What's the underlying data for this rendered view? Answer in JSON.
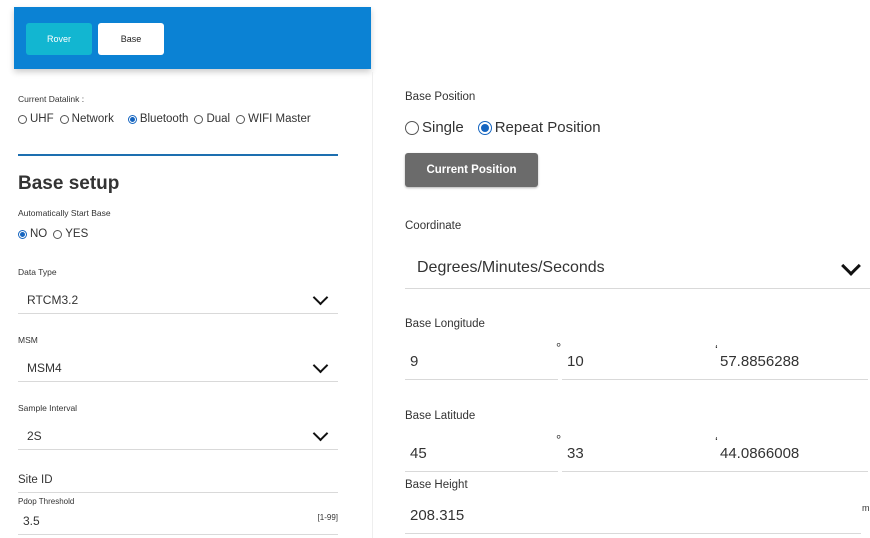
{
  "tabs": {
    "rover": "Rover",
    "base": "Base"
  },
  "datalink": {
    "label": "Current Datalink :",
    "options": [
      "UHF",
      "Network",
      "Bluetooth",
      "Dual",
      "WIFI Master"
    ],
    "selected": "Bluetooth"
  },
  "base_setup": {
    "title": "Base setup",
    "auto_start": {
      "label": "Automatically Start Base",
      "options": [
        "NO",
        "YES"
      ],
      "selected": "NO"
    },
    "data_type": {
      "label": "Data Type",
      "value": "RTCM3.2"
    },
    "msm": {
      "label": "MSM",
      "value": "MSM4"
    },
    "sample_interval": {
      "label": "Sample Interval",
      "value": "2S"
    },
    "site_id": {
      "label": "Site ID"
    },
    "pdop": {
      "label": "Pdop Threshold",
      "value": "3.5",
      "range": "[1-99]"
    }
  },
  "base_position": {
    "label": "Base Position",
    "options": [
      "Single",
      "Repeat Position"
    ],
    "selected": "Repeat Position",
    "current_button": "Current Position"
  },
  "coordinate": {
    "label": "Coordinate",
    "value": "Degrees/Minutes/Seconds"
  },
  "longitude": {
    "label": "Base Longitude",
    "deg": "9",
    "min": "10",
    "sec": "57.8856288"
  },
  "latitude": {
    "label": "Base Latitude",
    "deg": "45",
    "min": "33",
    "sec": "44.0866008"
  },
  "height": {
    "label": "Base Height",
    "value": "208.315",
    "unit": "m"
  },
  "units": {
    "deg": "°",
    "min": "‘"
  },
  "colors": {
    "header": "#0b82d4",
    "rover_tab": "#12b6d1",
    "radio_on": "#1565c0",
    "button": "#6b6b6b"
  }
}
